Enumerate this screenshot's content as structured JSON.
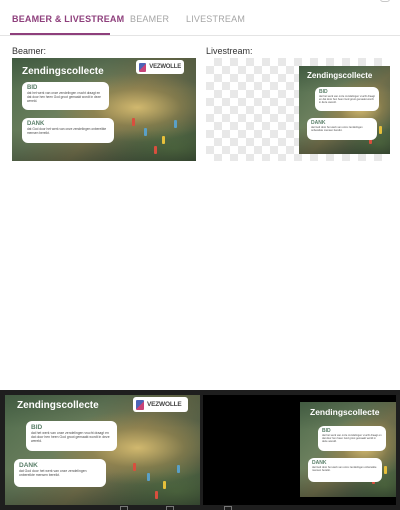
{
  "tabs": [
    {
      "label": "BEAMER & LIVESTREAM",
      "active": true
    },
    {
      "label": "BEAMER",
      "active": false
    },
    {
      "label": "LIVESTREAM",
      "active": false
    }
  ],
  "sections": {
    "beamer_label": "Beamer:",
    "livestream_label": "Livestream:"
  },
  "slide": {
    "title": "Zendingscollecte",
    "logo_text": "VEZWOLLE",
    "cards": [
      {
        "title": "BID",
        "body": "dat het werk van onze zendelingen vrucht draagt en dat door hen heen God groot gemaakt wordt in deze wereld."
      },
      {
        "title": "DANK",
        "body": "dat God door het werk van onze zendelingen onbereikte mensen bereikt."
      }
    ]
  },
  "colors": {
    "accent": "#8e3f7c",
    "card_title": "#5a7f69",
    "bottom_bar": "#1e1e1e"
  }
}
